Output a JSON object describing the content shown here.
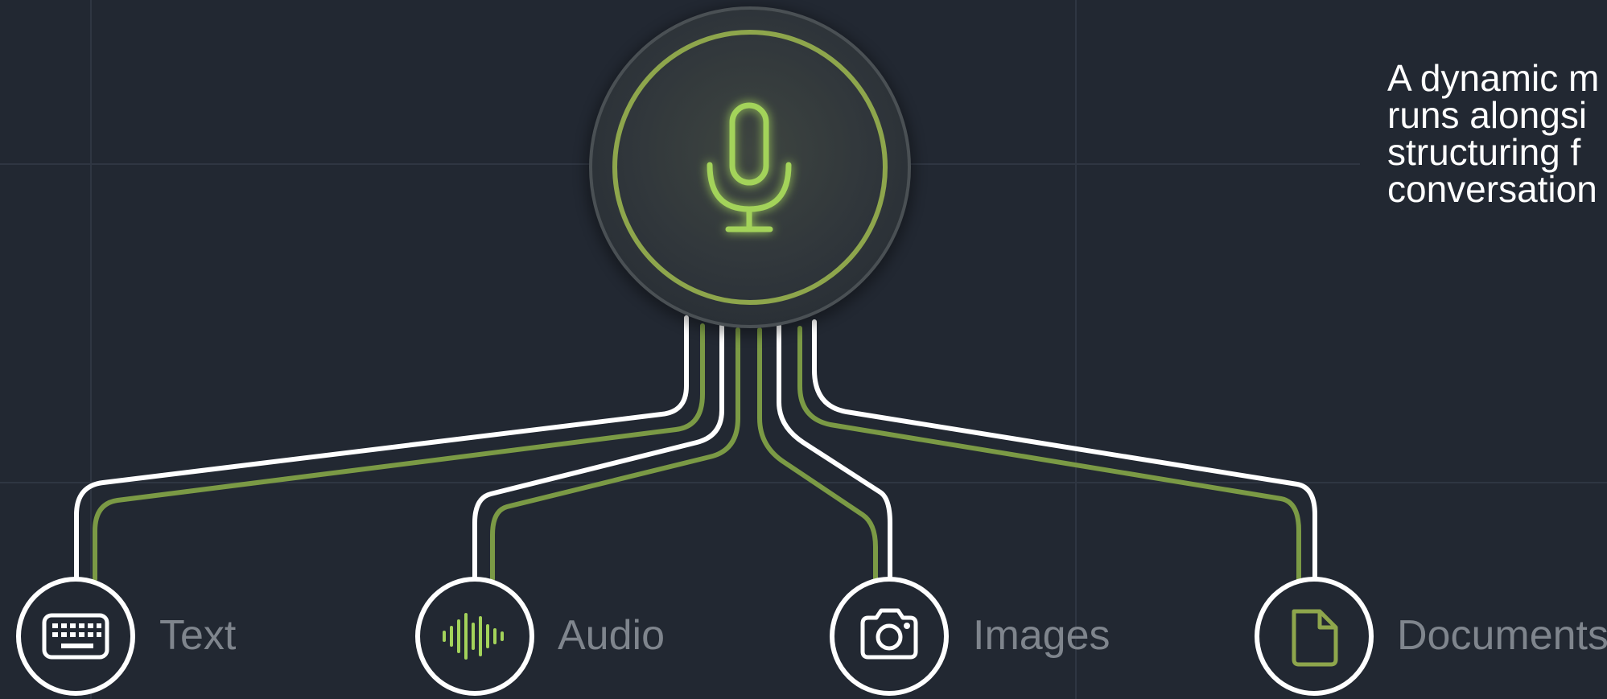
{
  "description_lines": [
    "A dynamic m",
    "runs alongsi",
    "structuring f",
    "conversation"
  ],
  "hub": {
    "icon": "microphone-icon"
  },
  "nodes": [
    {
      "label": "Text",
      "icon": "keyboard-icon"
    },
    {
      "label": "Audio",
      "icon": "audio-waveform-icon"
    },
    {
      "label": "Images",
      "icon": "camera-icon"
    },
    {
      "label": "Documents",
      "icon": "document-icon"
    }
  ],
  "colors": {
    "background": "#222832",
    "accent": "#a3d35a",
    "line_white": "#ffffff",
    "line_green": "#7b9a45",
    "label_gray": "#7f858d"
  }
}
